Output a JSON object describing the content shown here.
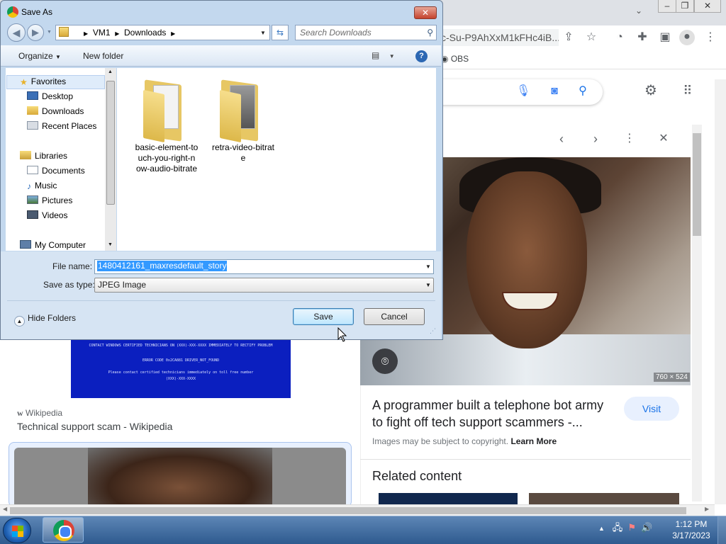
{
  "browser": {
    "url_fragment": "c-Su-P9AhXxM1kFHc4iB...",
    "bookmark_obs": "OBS",
    "window_controls": [
      "minimize",
      "restore",
      "close"
    ],
    "side_panel": {
      "image_dimensions": "760 × 524",
      "title": "A programmer built a telephone bot army to fight off tech support scammers -...",
      "visit_label": "Visit",
      "copyright_text": "Images may be subject to copyright.",
      "learn_more": "Learn More",
      "related_heading": "Related content"
    },
    "results": {
      "bsod_lines": [
        "CONTACT WINDOWS CERTIFIED TECHNICIANS ON (XXX)-XXX-XXXX IMMEDIATELY TO RECTIFY PROBLEM",
        "ERROR CODE 0x2CA881 DRIVER_NOT_FOUND",
        "Please contact certified technicians immediately on toll free number",
        "(XXX)-XXX-XXXX"
      ],
      "source": "Wikipedia",
      "title": "Technical support scam - Wikipedia"
    }
  },
  "dialog": {
    "title": "Save As",
    "close_label": "✕",
    "breadcrumb": [
      "VM1",
      "Downloads"
    ],
    "search_placeholder": "Search Downloads",
    "organize_label": "Organize",
    "new_folder_label": "New folder",
    "help_label": "?",
    "nav": {
      "favorites": "Favorites",
      "desktop": "Desktop",
      "downloads": "Downloads",
      "recent_places": "Recent Places",
      "libraries": "Libraries",
      "documents": "Documents",
      "music": "Music",
      "pictures": "Pictures",
      "videos": "Videos",
      "my_computer": "My Computer"
    },
    "files": [
      {
        "name": "basic-element-to uch-you-right-n ow-audio-bitrate",
        "lines": [
          "basic-element-to",
          "uch-you-right-n",
          "ow-audio-bitrate"
        ]
      },
      {
        "name": "retra-video-bitrate",
        "lines": [
          "retra-video-bitrat",
          "e"
        ]
      }
    ],
    "file_name_label": "File name:",
    "file_name_value": "1480412161_maxresdefault_story",
    "save_type_label": "Save as type:",
    "save_type_value": "JPEG Image",
    "hide_folders_label": "Hide Folders",
    "save_label": "Save",
    "cancel_label": "Cancel"
  },
  "taskbar": {
    "time": "1:12 PM",
    "date": "3/17/2023"
  },
  "colors": {
    "dialog_chrome": "#c3d8ee",
    "selection": "#3399ff",
    "taskbar": "#2e5a8f",
    "google_blue": "#1a73e8",
    "bsod_blue": "#0b1fbf"
  }
}
